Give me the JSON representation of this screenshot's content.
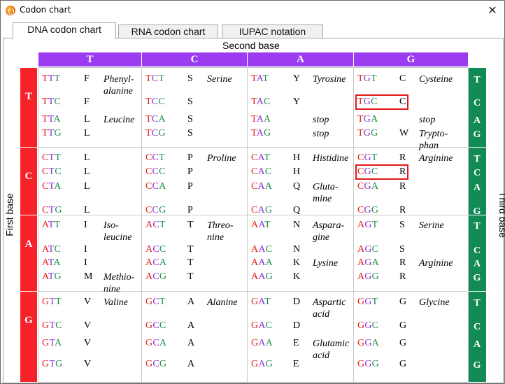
{
  "window": {
    "title": "Codon chart",
    "close_glyph": "✕",
    "icon": "app-icon"
  },
  "tabs": [
    {
      "label": "DNA codon chart",
      "active": true
    },
    {
      "label": "RNA codon chart",
      "active": false
    },
    {
      "label": "IUPAC notation",
      "active": false
    }
  ],
  "chart": {
    "second_base_label": "Second base",
    "first_base_label": "First base",
    "third_base_label": "Third base",
    "second_bases": [
      "T",
      "C",
      "A",
      "G"
    ],
    "first_bases": [
      "T",
      "C",
      "A",
      "G"
    ],
    "third_bases": [
      "T",
      "C",
      "A",
      "G"
    ],
    "colors": {
      "header_purple": "#9b3cf0",
      "first_red": "#f5222a",
      "third_green": "#128a55",
      "highlight": "#e01818"
    },
    "highlighted_codons": [
      "TGC",
      "CGC"
    ],
    "blocks": [
      [
        {
          "codons": [
            "TTT",
            "TTC",
            "TTA",
            "TTG"
          ],
          "aa": [
            "F",
            "F",
            "L",
            "L"
          ],
          "names": [
            [
              "Phenyl-",
              "alanine"
            ],
            [],
            [
              "Leucine"
            ],
            []
          ]
        },
        {
          "codons": [
            "TCT",
            "TCC",
            "TCA",
            "TCG"
          ],
          "aa": [
            "S",
            "S",
            "S",
            "S"
          ],
          "names": [
            [
              "Serine"
            ],
            [],
            [],
            []
          ]
        },
        {
          "codons": [
            "TAT",
            "TAC",
            "TAA",
            "TAG"
          ],
          "aa": [
            "Y",
            "Y",
            "",
            ""
          ],
          "names": [
            [
              "Tyrosine"
            ],
            [],
            [
              "stop"
            ],
            [
              "stop"
            ]
          ]
        },
        {
          "codons": [
            "TGT",
            "TGC",
            "TGA",
            "TGG"
          ],
          "aa": [
            "C",
            "C",
            "",
            "W"
          ],
          "names": [
            [
              "Cysteine"
            ],
            [],
            [
              "stop"
            ],
            [
              "Trypto-",
              "phan"
            ]
          ]
        }
      ],
      [
        {
          "codons": [
            "CTT",
            "CTC",
            "CTA",
            "CTG"
          ],
          "aa": [
            "L",
            "L",
            "L",
            "L"
          ],
          "names": [
            [],
            [],
            [],
            []
          ]
        },
        {
          "codons": [
            "CCT",
            "CCC",
            "CCA",
            "CCG"
          ],
          "aa": [
            "P",
            "P",
            "P",
            "P"
          ],
          "names": [
            [
              "Proline"
            ],
            [],
            [],
            []
          ]
        },
        {
          "codons": [
            "CAT",
            "CAC",
            "CAA",
            "CAG"
          ],
          "aa": [
            "H",
            "H",
            "Q",
            "Q"
          ],
          "names": [
            [
              "Histidine"
            ],
            [],
            [
              "Gluta-",
              "mine"
            ],
            []
          ]
        },
        {
          "codons": [
            "CGT",
            "CGC",
            "CGA",
            "CGG"
          ],
          "aa": [
            "R",
            "R",
            "R",
            "R"
          ],
          "names": [
            [
              "Arginine"
            ],
            [],
            [],
            []
          ]
        }
      ],
      [
        {
          "codons": [
            "ATT",
            "ATC",
            "ATA",
            "ATG"
          ],
          "aa": [
            "I",
            "I",
            "I",
            "M"
          ],
          "names": [
            [
              "Iso-",
              "leucine"
            ],
            [],
            [],
            [
              "Methio-",
              "nine"
            ]
          ]
        },
        {
          "codons": [
            "ACT",
            "ACC",
            "ACA",
            "ACG"
          ],
          "aa": [
            "T",
            "T",
            "T",
            "T"
          ],
          "names": [
            [
              "Threo-",
              "nine"
            ],
            [],
            [],
            []
          ]
        },
        {
          "codons": [
            "AAT",
            "AAC",
            "AAA",
            "AAG"
          ],
          "aa": [
            "N",
            "N",
            "K",
            "K"
          ],
          "names": [
            [
              "Aspara-",
              "gine"
            ],
            [],
            [
              "Lysine"
            ],
            []
          ]
        },
        {
          "codons": [
            "AGT",
            "AGC",
            "AGA",
            "AGG"
          ],
          "aa": [
            "S",
            "S",
            "R",
            "R"
          ],
          "names": [
            [
              "Serine"
            ],
            [],
            [
              "Arginine"
            ],
            []
          ]
        }
      ],
      [
        {
          "codons": [
            "GTT",
            "GTC",
            "GTA",
            "GTG"
          ],
          "aa": [
            "V",
            "V",
            "V",
            "V"
          ],
          "names": [
            [
              "Valine"
            ],
            [],
            [],
            []
          ]
        },
        {
          "codons": [
            "GCT",
            "GCC",
            "GCA",
            "GCG"
          ],
          "aa": [
            "A",
            "A",
            "A",
            "A"
          ],
          "names": [
            [
              "Alanine"
            ],
            [],
            [],
            []
          ]
        },
        {
          "codons": [
            "GAT",
            "GAC",
            "GAA",
            "GAG"
          ],
          "aa": [
            "D",
            "D",
            "E",
            "E"
          ],
          "names": [
            [
              "Aspartic",
              "acid"
            ],
            [],
            [
              "Glutamic",
              "acid"
            ],
            []
          ]
        },
        {
          "codons": [
            "GGT",
            "GGC",
            "GGA",
            "GGG"
          ],
          "aa": [
            "G",
            "G",
            "G",
            "G"
          ],
          "names": [
            [
              "Glycine"
            ],
            [],
            [],
            []
          ]
        }
      ]
    ]
  }
}
